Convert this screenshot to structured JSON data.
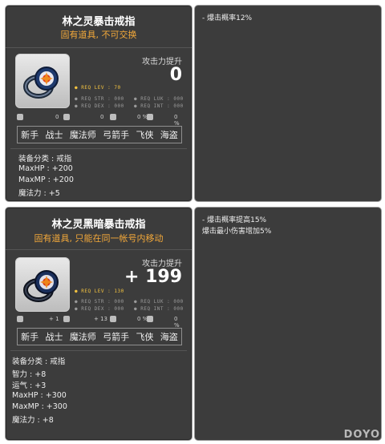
{
  "item1": {
    "title": "林之灵暴击戒指",
    "subtitle": "固有道具, 不可交换",
    "atk_label": "攻击力提升",
    "atk_value": "0",
    "req_lev": "● REQ LEV :  70",
    "req_str": "● REQ STR : 000",
    "req_luk": "● REQ LUK : 000",
    "req_dex": "● REQ DEX : 000",
    "req_int": "● REQ INT : 000",
    "stat_a": "0",
    "stat_b": "0",
    "stat_c": "0 %",
    "stat_d": "0 %",
    "jobs": [
      "新手",
      "战士",
      "魔法师",
      "弓箭手",
      "飞侠",
      "海盗"
    ],
    "category": "装备分类 :  戒指",
    "lines": [
      "MaxHP :  +200",
      "MaxMP :  +200",
      "魔法力 :  +5"
    ],
    "tip": [
      "- 爆击概率12%"
    ]
  },
  "item2": {
    "title": "林之灵黑暗暴击戒指",
    "subtitle": "固有道具, 只能在同一帐号内移动",
    "atk_label": "攻击力提升",
    "atk_value": "+ 199",
    "req_lev": "● REQ LEV : 130",
    "req_str": "● REQ STR : 000",
    "req_luk": "● REQ LUK : 000",
    "req_dex": "● REQ DEX : 000",
    "req_int": "● REQ INT : 000",
    "stat_a": "+ 1",
    "stat_b": "+ 13",
    "stat_c": "0 %",
    "stat_d": "0 %",
    "jobs": [
      "新手",
      "战士",
      "魔法师",
      "弓箭手",
      "飞侠",
      "海盗"
    ],
    "category": "装备分类 :  戒指",
    "lines": [
      "智力 :  +8",
      "运气 :  +3",
      "MaxHP :  +300",
      "MaxMP :  +300",
      "魔法力 :  +8"
    ],
    "tip": [
      "- 爆击概率提高15%",
      "爆击最小伤害增加5%"
    ]
  },
  "watermark": "DOYO"
}
